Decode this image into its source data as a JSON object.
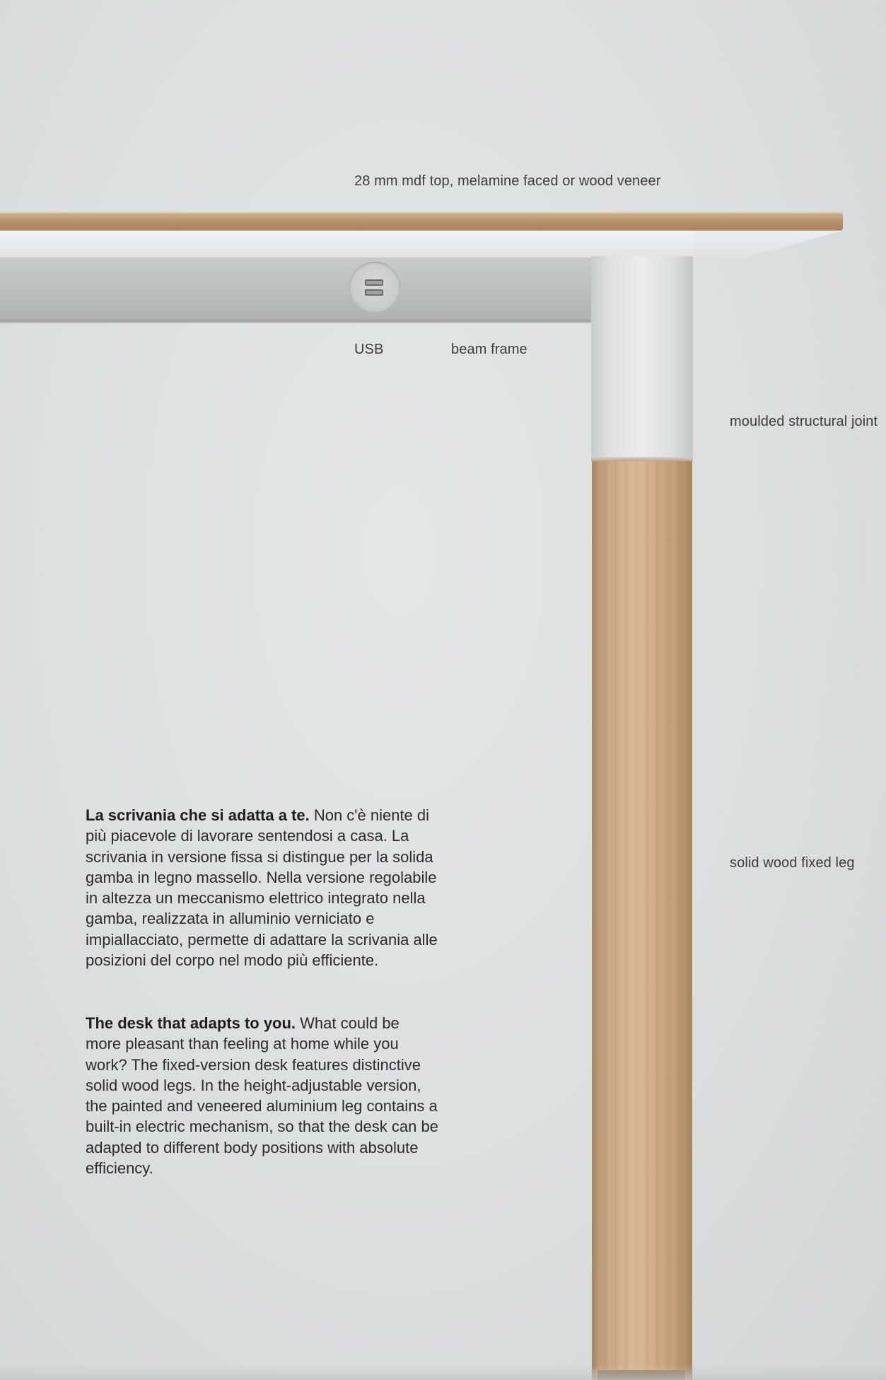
{
  "annotations": {
    "top": "28 mm mdf top, melamine faced or wood veneer",
    "usb": "USB",
    "beam": "beam frame",
    "joint": "moulded structural joint",
    "leg": "solid wood fixed leg"
  },
  "description_it": {
    "heading": "La scrivania che si adatta a te.",
    "body": " Non c'è niente di più piacevole di lavorare sentendosi a casa. La scrivania in versione fissa si distingue per la solida gamba in legno massello. Nella versione regolabile in altezza un meccanismo elettrico integrato nella gamba, realizzata in alluminio verniciato e impiallacciato, permette di adattare la scrivania alle posizioni del corpo nel modo più efficiente."
  },
  "description_en": {
    "heading": "The desk that adapts to you.",
    "body": " What could be more pleasant than feeling at home while you work? The fixed-version desk features distinctive solid wood legs. In the height-adjustable version, the painted and veneered aluminium leg contains a built-in electric mechanism, so that the desk can be adapted to different body positions with absolute efficiency."
  },
  "colors": {
    "background": "#dcdfdf",
    "wood": "#d2b08a",
    "frame": "#b9bcbd"
  }
}
